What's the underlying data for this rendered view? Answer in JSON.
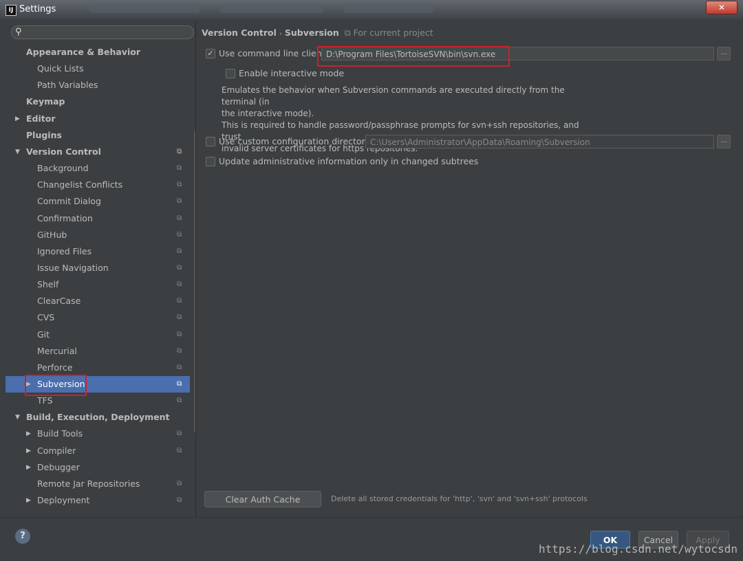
{
  "window": {
    "title": "Settings",
    "app_icon": "IJ",
    "close_label": "✕"
  },
  "sidebar": {
    "search_placeholder": "",
    "items": [
      {
        "label": "Appearance & Behavior",
        "bold": true,
        "indent": 1,
        "arrow": "",
        "project_icon": false
      },
      {
        "label": "Quick Lists",
        "bold": false,
        "indent": 2,
        "arrow": "",
        "project_icon": false
      },
      {
        "label": "Path Variables",
        "bold": false,
        "indent": 2,
        "arrow": "",
        "project_icon": false
      },
      {
        "label": "Keymap",
        "bold": true,
        "indent": 1,
        "arrow": "",
        "project_icon": false
      },
      {
        "label": "Editor",
        "bold": true,
        "indent": 1,
        "arrow": "▶",
        "project_icon": false
      },
      {
        "label": "Plugins",
        "bold": true,
        "indent": 1,
        "arrow": "",
        "project_icon": false
      },
      {
        "label": "Version Control",
        "bold": true,
        "indent": 1,
        "arrow": "▼",
        "project_icon": true
      },
      {
        "label": "Background",
        "bold": false,
        "indent": 2,
        "arrow": "",
        "project_icon": true
      },
      {
        "label": "Changelist Conflicts",
        "bold": false,
        "indent": 2,
        "arrow": "",
        "project_icon": true
      },
      {
        "label": "Commit Dialog",
        "bold": false,
        "indent": 2,
        "arrow": "",
        "project_icon": true
      },
      {
        "label": "Confirmation",
        "bold": false,
        "indent": 2,
        "arrow": "",
        "project_icon": true
      },
      {
        "label": "GitHub",
        "bold": false,
        "indent": 2,
        "arrow": "",
        "project_icon": true
      },
      {
        "label": "Ignored Files",
        "bold": false,
        "indent": 2,
        "arrow": "",
        "project_icon": true
      },
      {
        "label": "Issue Navigation",
        "bold": false,
        "indent": 2,
        "arrow": "",
        "project_icon": true
      },
      {
        "label": "Shelf",
        "bold": false,
        "indent": 2,
        "arrow": "",
        "project_icon": true
      },
      {
        "label": "ClearCase",
        "bold": false,
        "indent": 2,
        "arrow": "",
        "project_icon": true
      },
      {
        "label": "CVS",
        "bold": false,
        "indent": 2,
        "arrow": "",
        "project_icon": true
      },
      {
        "label": "Git",
        "bold": false,
        "indent": 2,
        "arrow": "",
        "project_icon": true
      },
      {
        "label": "Mercurial",
        "bold": false,
        "indent": 2,
        "arrow": "",
        "project_icon": true
      },
      {
        "label": "Perforce",
        "bold": false,
        "indent": 2,
        "arrow": "",
        "project_icon": true
      },
      {
        "label": "Subversion",
        "bold": false,
        "indent": 2,
        "arrow": "▶",
        "project_icon": true,
        "selected": true
      },
      {
        "label": "TFS",
        "bold": false,
        "indent": 2,
        "arrow": "",
        "project_icon": true
      },
      {
        "label": "Build, Execution, Deployment",
        "bold": true,
        "indent": 1,
        "arrow": "▼",
        "project_icon": false
      },
      {
        "label": "Build Tools",
        "bold": false,
        "indent": 2,
        "arrow": "▶",
        "project_icon": true
      },
      {
        "label": "Compiler",
        "bold": false,
        "indent": 2,
        "arrow": "▶",
        "project_icon": true
      },
      {
        "label": "Debugger",
        "bold": false,
        "indent": 2,
        "arrow": "▶",
        "project_icon": false
      },
      {
        "label": "Remote Jar Repositories",
        "bold": false,
        "indent": 2,
        "arrow": "",
        "project_icon": true
      },
      {
        "label": "Deployment",
        "bold": false,
        "indent": 2,
        "arrow": "▶",
        "project_icon": true
      }
    ]
  },
  "breadcrumb": {
    "parent": "Version Control",
    "separator": "›",
    "current": "Subversion",
    "scope_icon": "⧉",
    "scope": "For current project"
  },
  "options": {
    "use_command_line_label": "Use command line client:",
    "command_line_path": "D:\\Program Files\\TortoiseSVN\\bin\\svn.exe",
    "interactive_label": "Enable interactive mode",
    "description_lines": [
      "Emulates the behavior when Subversion commands are executed directly from the terminal (in",
      "the interactive mode).",
      "This is required to handle password/passphrase prompts for svn+ssh repositories, and trust",
      "invalid server certificates for https repositories."
    ],
    "custom_config_label": "Use custom configuration directory:",
    "custom_config_path": "C:\\Users\\Administrator\\AppData\\Roaming\\Subversion",
    "update_admin_label": "Update administrative information only in changed subtrees",
    "browse_label": "...",
    "use_command_line_checked": true,
    "interactive_checked": false,
    "custom_config_checked": false,
    "update_admin_checked": false
  },
  "auth": {
    "clear_button": "Clear Auth Cache",
    "clear_description": "Delete all stored credentials for 'http', 'svn' and 'svn+ssh' protocols"
  },
  "footer": {
    "help": "?",
    "ok": "OK",
    "cancel": "Cancel",
    "apply": "Apply"
  },
  "watermark": "https://blog.csdn.net/wytocsdn",
  "colors": {
    "selection": "#4b6eaf",
    "highlight_box": "#d0202a",
    "ok_button": "#365880",
    "background": "#3c3f41"
  }
}
